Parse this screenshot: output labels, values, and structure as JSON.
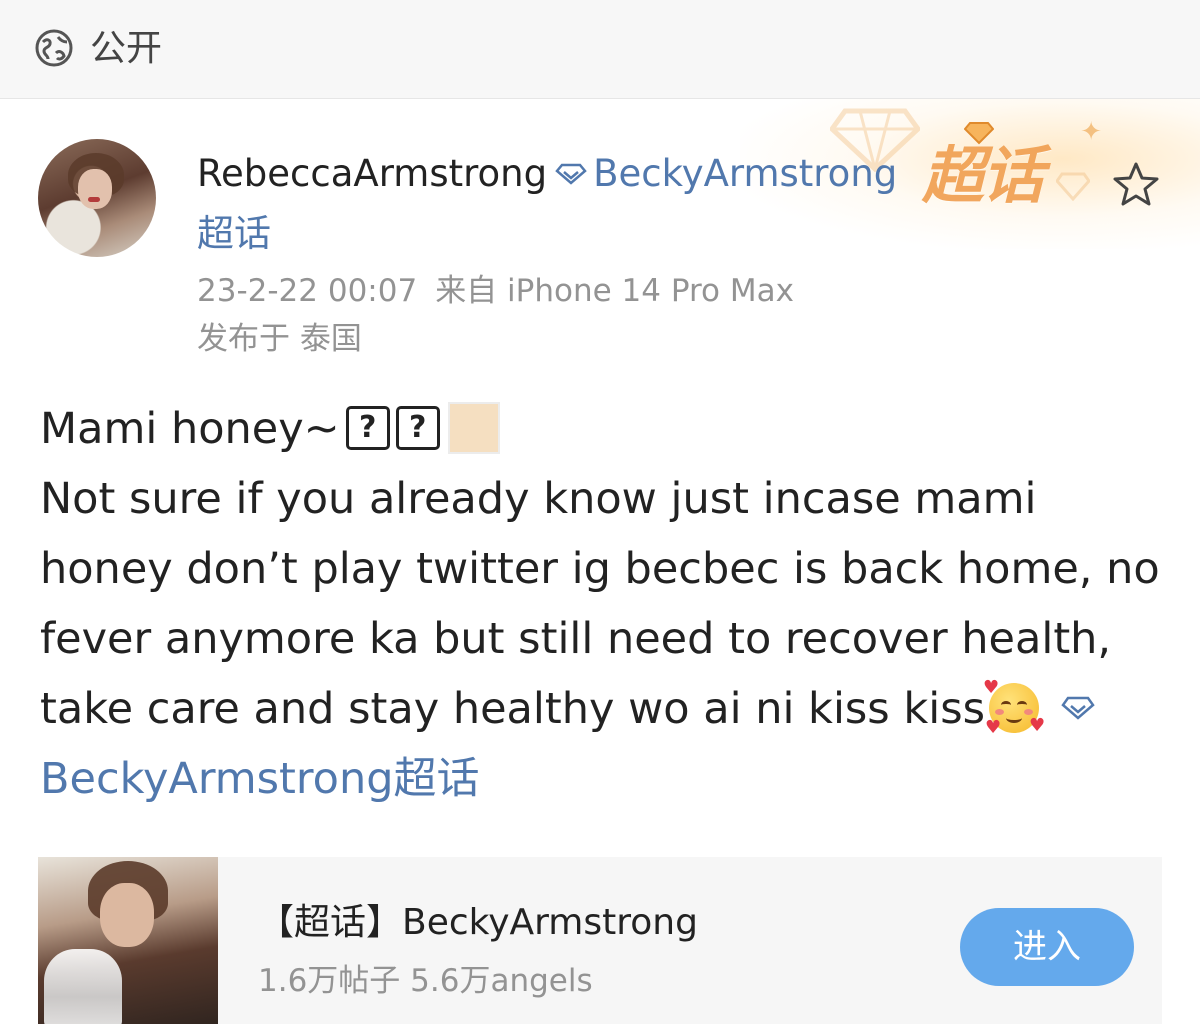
{
  "header": {
    "visibility_label": "公开",
    "icon": "globe-icon"
  },
  "post": {
    "author_name": "RebeccaArmstrong",
    "topic_name": "BeckyArmstrong",
    "topic_suffix": "超话",
    "super_topic_badge": "超话",
    "timestamp": "23-2-22 00:07",
    "source": "来自 iPhone 14 Pro Max",
    "location": "发布于 泰国",
    "content_line1": "Mami honey~",
    "content_unknown_glyph": "?",
    "content_body": "Not sure if you already know just incase mami honey don’t play twitter ig becbec is back home, no fever anymore ka but still need to recover health, take care and stay healthy wo ai ni kiss kiss",
    "content_topic": "BeckyArmstrong超话",
    "emoji": "smiling-face-with-hearts"
  },
  "topic_card": {
    "title": "【超话】BeckyArmstrong",
    "stats": "1.6万帖子 5.6万angels",
    "enter_label": "进入"
  },
  "colors": {
    "link": "#5178ad",
    "button": "#64a9ec",
    "badge": "#f0a052",
    "meta": "#939393"
  }
}
